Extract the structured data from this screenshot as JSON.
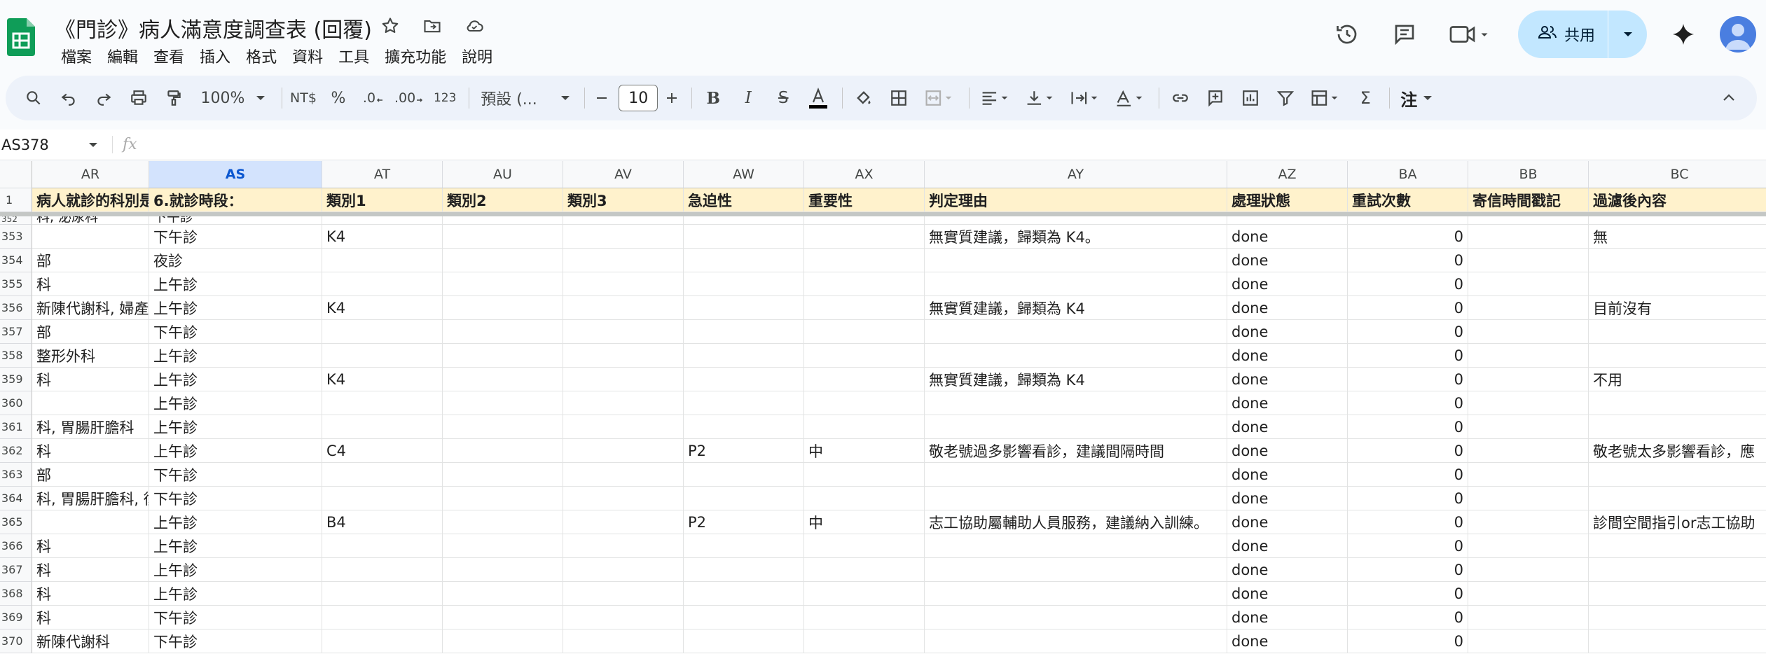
{
  "app": {
    "title": "《門診》病人滿意度調查表 (回覆)",
    "menu": [
      "檔案",
      "編輯",
      "查看",
      "插入",
      "格式",
      "資料",
      "工具",
      "擴充功能",
      "說明"
    ],
    "share_label": "共用"
  },
  "toolbar": {
    "zoom": "100%",
    "currency": "NT$",
    "percent": "%",
    "dec_decrease": ".0",
    "dec_increase": ".00",
    "number_format": "123",
    "font": "預設 (...",
    "font_size": "10",
    "comment_label": "注"
  },
  "formula_bar": {
    "name_box": "AS378",
    "fx_label": "fx"
  },
  "columns": [
    {
      "id": "AR",
      "selected": false
    },
    {
      "id": "AS",
      "selected": true
    },
    {
      "id": "AT",
      "selected": false
    },
    {
      "id": "AU",
      "selected": false
    },
    {
      "id": "AV",
      "selected": false
    },
    {
      "id": "AW",
      "selected": false
    },
    {
      "id": "AX",
      "selected": false
    },
    {
      "id": "AY",
      "selected": false
    },
    {
      "id": "AZ",
      "selected": false
    },
    {
      "id": "BA",
      "selected": false
    },
    {
      "id": "BB",
      "selected": false
    },
    {
      "id": "BC",
      "selected": false
    }
  ],
  "header_row": {
    "row_number": "1",
    "cells": [
      "病人就診的科別是",
      "6.就診時段：",
      "類別1",
      "類別2",
      "類別3",
      "急迫性",
      "重要性",
      "判定理由",
      "處理狀態",
      "重試次數",
      "寄信時間戳記",
      "過濾後內容"
    ]
  },
  "partial_row": {
    "row_number": "352",
    "cells": [
      "科, 泌尿科",
      "下午診"
    ]
  },
  "rows": [
    {
      "row_number": "353",
      "cells": [
        "",
        "下午診",
        "K4",
        "",
        "",
        "",
        "",
        "無實質建議，歸類為 K4。",
        "done",
        "0",
        "",
        "無"
      ]
    },
    {
      "row_number": "354",
      "cells": [
        "部",
        "夜診",
        "",
        "",
        "",
        "",
        "",
        "",
        "done",
        "0",
        "",
        ""
      ]
    },
    {
      "row_number": "355",
      "cells": [
        "科",
        "上午診",
        "",
        "",
        "",
        "",
        "",
        "",
        "done",
        "0",
        "",
        ""
      ]
    },
    {
      "row_number": "356",
      "cells": [
        "新陳代謝科, 婦產",
        "上午診",
        "K4",
        "",
        "",
        "",
        "",
        "無實質建議，歸類為 K4",
        "done",
        "0",
        "",
        "目前沒有"
      ]
    },
    {
      "row_number": "357",
      "cells": [
        "部",
        "下午診",
        "",
        "",
        "",
        "",
        "",
        "",
        "done",
        "0",
        "",
        ""
      ]
    },
    {
      "row_number": "358",
      "cells": [
        "整形外科",
        "上午診",
        "",
        "",
        "",
        "",
        "",
        "",
        "done",
        "0",
        "",
        ""
      ]
    },
    {
      "row_number": "359",
      "cells": [
        "科",
        "上午診",
        "K4",
        "",
        "",
        "",
        "",
        "無實質建議，歸類為 K4",
        "done",
        "0",
        "",
        "不用"
      ]
    },
    {
      "row_number": "360",
      "cells": [
        "",
        "上午診",
        "",
        "",
        "",
        "",
        "",
        "",
        "done",
        "0",
        "",
        ""
      ]
    },
    {
      "row_number": "361",
      "cells": [
        "科, 胃腸肝膽科",
        "上午診",
        "",
        "",
        "",
        "",
        "",
        "",
        "done",
        "0",
        "",
        ""
      ]
    },
    {
      "row_number": "362",
      "cells": [
        "科",
        "上午診",
        "C4",
        "",
        "",
        "P2",
        "中",
        "敬老號過多影響看診，建議間隔時間",
        "done",
        "0",
        "",
        "敬老號太多影響看診，應"
      ]
    },
    {
      "row_number": "363",
      "cells": [
        "部",
        "下午診",
        "",
        "",
        "",
        "",
        "",
        "",
        "done",
        "0",
        "",
        ""
      ]
    },
    {
      "row_number": "364",
      "cells": [
        "科, 胃腸肝膽科, 復",
        "下午診",
        "",
        "",
        "",
        "",
        "",
        "",
        "done",
        "0",
        "",
        ""
      ]
    },
    {
      "row_number": "365",
      "cells": [
        "",
        "上午診",
        "B4",
        "",
        "",
        "P2",
        "中",
        "志工協助屬輔助人員服務，建議納入訓練。",
        "done",
        "0",
        "",
        "診間空間指引or志工協助"
      ]
    },
    {
      "row_number": "366",
      "cells": [
        "科",
        "上午診",
        "",
        "",
        "",
        "",
        "",
        "",
        "done",
        "0",
        "",
        ""
      ]
    },
    {
      "row_number": "367",
      "cells": [
        "科",
        "上午診",
        "",
        "",
        "",
        "",
        "",
        "",
        "done",
        "0",
        "",
        ""
      ]
    },
    {
      "row_number": "368",
      "cells": [
        "科",
        "上午診",
        "",
        "",
        "",
        "",
        "",
        "",
        "done",
        "0",
        "",
        ""
      ]
    },
    {
      "row_number": "369",
      "cells": [
        "科",
        "下午診",
        "",
        "",
        "",
        "",
        "",
        "",
        "done",
        "0",
        "",
        ""
      ]
    },
    {
      "row_number": "370",
      "cells": [
        "新陳代謝科",
        "下午診",
        "",
        "",
        "",
        "",
        "",
        "",
        "done",
        "0",
        "",
        ""
      ]
    }
  ],
  "colors": {
    "header_fill": "#fff2cc",
    "selected_col": "#d3e3fd",
    "share_button": "#c2e7ff",
    "sheets_green": "#0f9d58"
  }
}
